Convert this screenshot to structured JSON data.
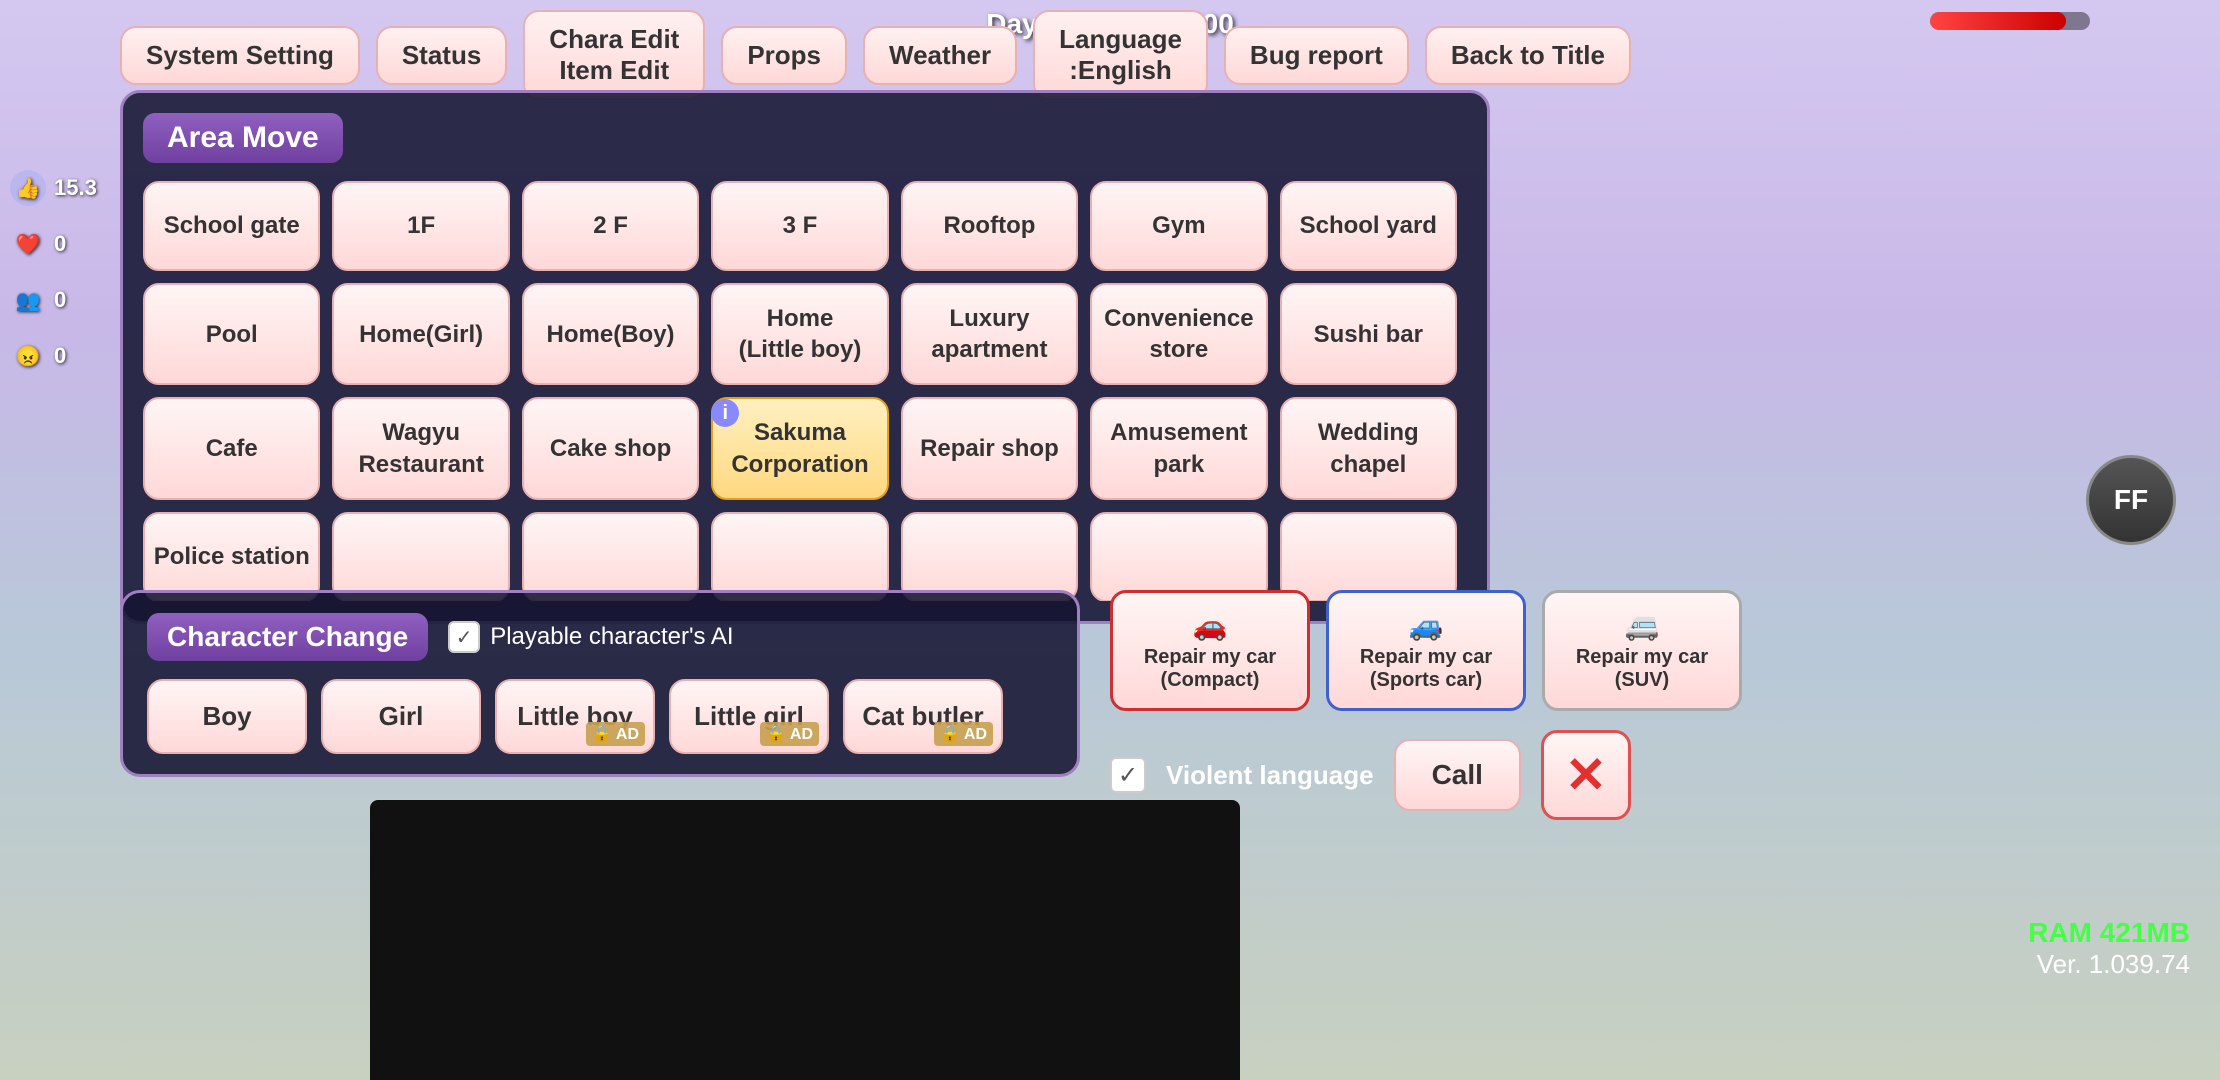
{
  "hud": {
    "day_time": "Day 1  07:42  ¥ 5000",
    "progress": 85
  },
  "top_menu": {
    "buttons": [
      {
        "id": "system-setting",
        "label": "System Setting"
      },
      {
        "id": "status",
        "label": "Status"
      },
      {
        "id": "chara-edit",
        "label": "Chara Edit\nItem Edit"
      },
      {
        "id": "props",
        "label": "Props"
      },
      {
        "id": "weather",
        "label": "Weather"
      },
      {
        "id": "language",
        "label": "Language\n:English"
      },
      {
        "id": "bug-report",
        "label": "Bug report"
      },
      {
        "id": "back-to-title",
        "label": "Back to Title"
      }
    ]
  },
  "area_move": {
    "title": "Area Move",
    "locations": [
      {
        "id": "school-gate",
        "label": "School gate"
      },
      {
        "id": "1f",
        "label": "1F"
      },
      {
        "id": "2f",
        "label": "2 F"
      },
      {
        "id": "3f",
        "label": "3 F"
      },
      {
        "id": "rooftop",
        "label": "Rooftop"
      },
      {
        "id": "gym",
        "label": "Gym"
      },
      {
        "id": "school-yard",
        "label": "School yard"
      },
      {
        "id": "pool",
        "label": "Pool"
      },
      {
        "id": "home-girl",
        "label": "Home(Girl)"
      },
      {
        "id": "home-boy",
        "label": "Home(Boy)"
      },
      {
        "id": "home-little-boy",
        "label": "Home\n(Little boy)"
      },
      {
        "id": "luxury-apartment",
        "label": "Luxury\napartment"
      },
      {
        "id": "convenience-store",
        "label": "Convenience\nstore"
      },
      {
        "id": "sushi-bar",
        "label": "Sushi bar"
      },
      {
        "id": "cafe",
        "label": "Cafe"
      },
      {
        "id": "wagyu-restaurant",
        "label": "Wagyu\nRestaurant"
      },
      {
        "id": "cake-shop",
        "label": "Cake shop",
        "highlighted": true
      },
      {
        "id": "sakuma-corporation",
        "label": "Sakuma\nCorporation",
        "highlighted": true
      },
      {
        "id": "repair-shop",
        "label": "Repair shop"
      },
      {
        "id": "amusement-park",
        "label": "Amusement\npark"
      },
      {
        "id": "wedding-chapel",
        "label": "Wedding\nchapel"
      },
      {
        "id": "police-station",
        "label": "Police station"
      },
      {
        "id": "extra1",
        "label": ""
      },
      {
        "id": "extra2",
        "label": ""
      },
      {
        "id": "extra3",
        "label": ""
      },
      {
        "id": "extra4",
        "label": ""
      },
      {
        "id": "extra5",
        "label": ""
      },
      {
        "id": "extra6",
        "label": ""
      }
    ]
  },
  "character_change": {
    "title": "Character Change",
    "ai_label": "Playable character's AI",
    "ai_checked": true,
    "characters": [
      {
        "id": "boy",
        "label": "Boy",
        "locked": false
      },
      {
        "id": "girl",
        "label": "Girl",
        "locked": false
      },
      {
        "id": "little-boy",
        "label": "Little boy",
        "locked": true,
        "ad": "AD"
      },
      {
        "id": "little-girl",
        "label": "Little girl",
        "locked": true,
        "ad": "AD"
      },
      {
        "id": "cat-butler",
        "label": "Cat butler",
        "locked": true,
        "ad": "AD"
      }
    ]
  },
  "repair_cars": {
    "compact": {
      "label": "Repair my car\n(Compact)",
      "color": "red"
    },
    "sports": {
      "label": "Repair my car\n(Sports car)",
      "color": "blue"
    },
    "suv": {
      "label": "Repair my car\n(SUV)",
      "color": "white"
    }
  },
  "violent_language": {
    "label": "Violent language",
    "checked": true
  },
  "call_button": "Call",
  "ff_button": "FF",
  "ram": "RAM 421MB",
  "version": "Ver. 1.039.74",
  "left_stats": [
    {
      "icon": "👍",
      "value": "15.3",
      "color": "#4488ff"
    },
    {
      "icon": "❤️",
      "value": "0",
      "color": "#ff4444"
    },
    {
      "icon": "👥",
      "value": "0",
      "color": "#44aa44"
    },
    {
      "icon": "😠",
      "value": "0",
      "color": "#ff8844"
    }
  ]
}
